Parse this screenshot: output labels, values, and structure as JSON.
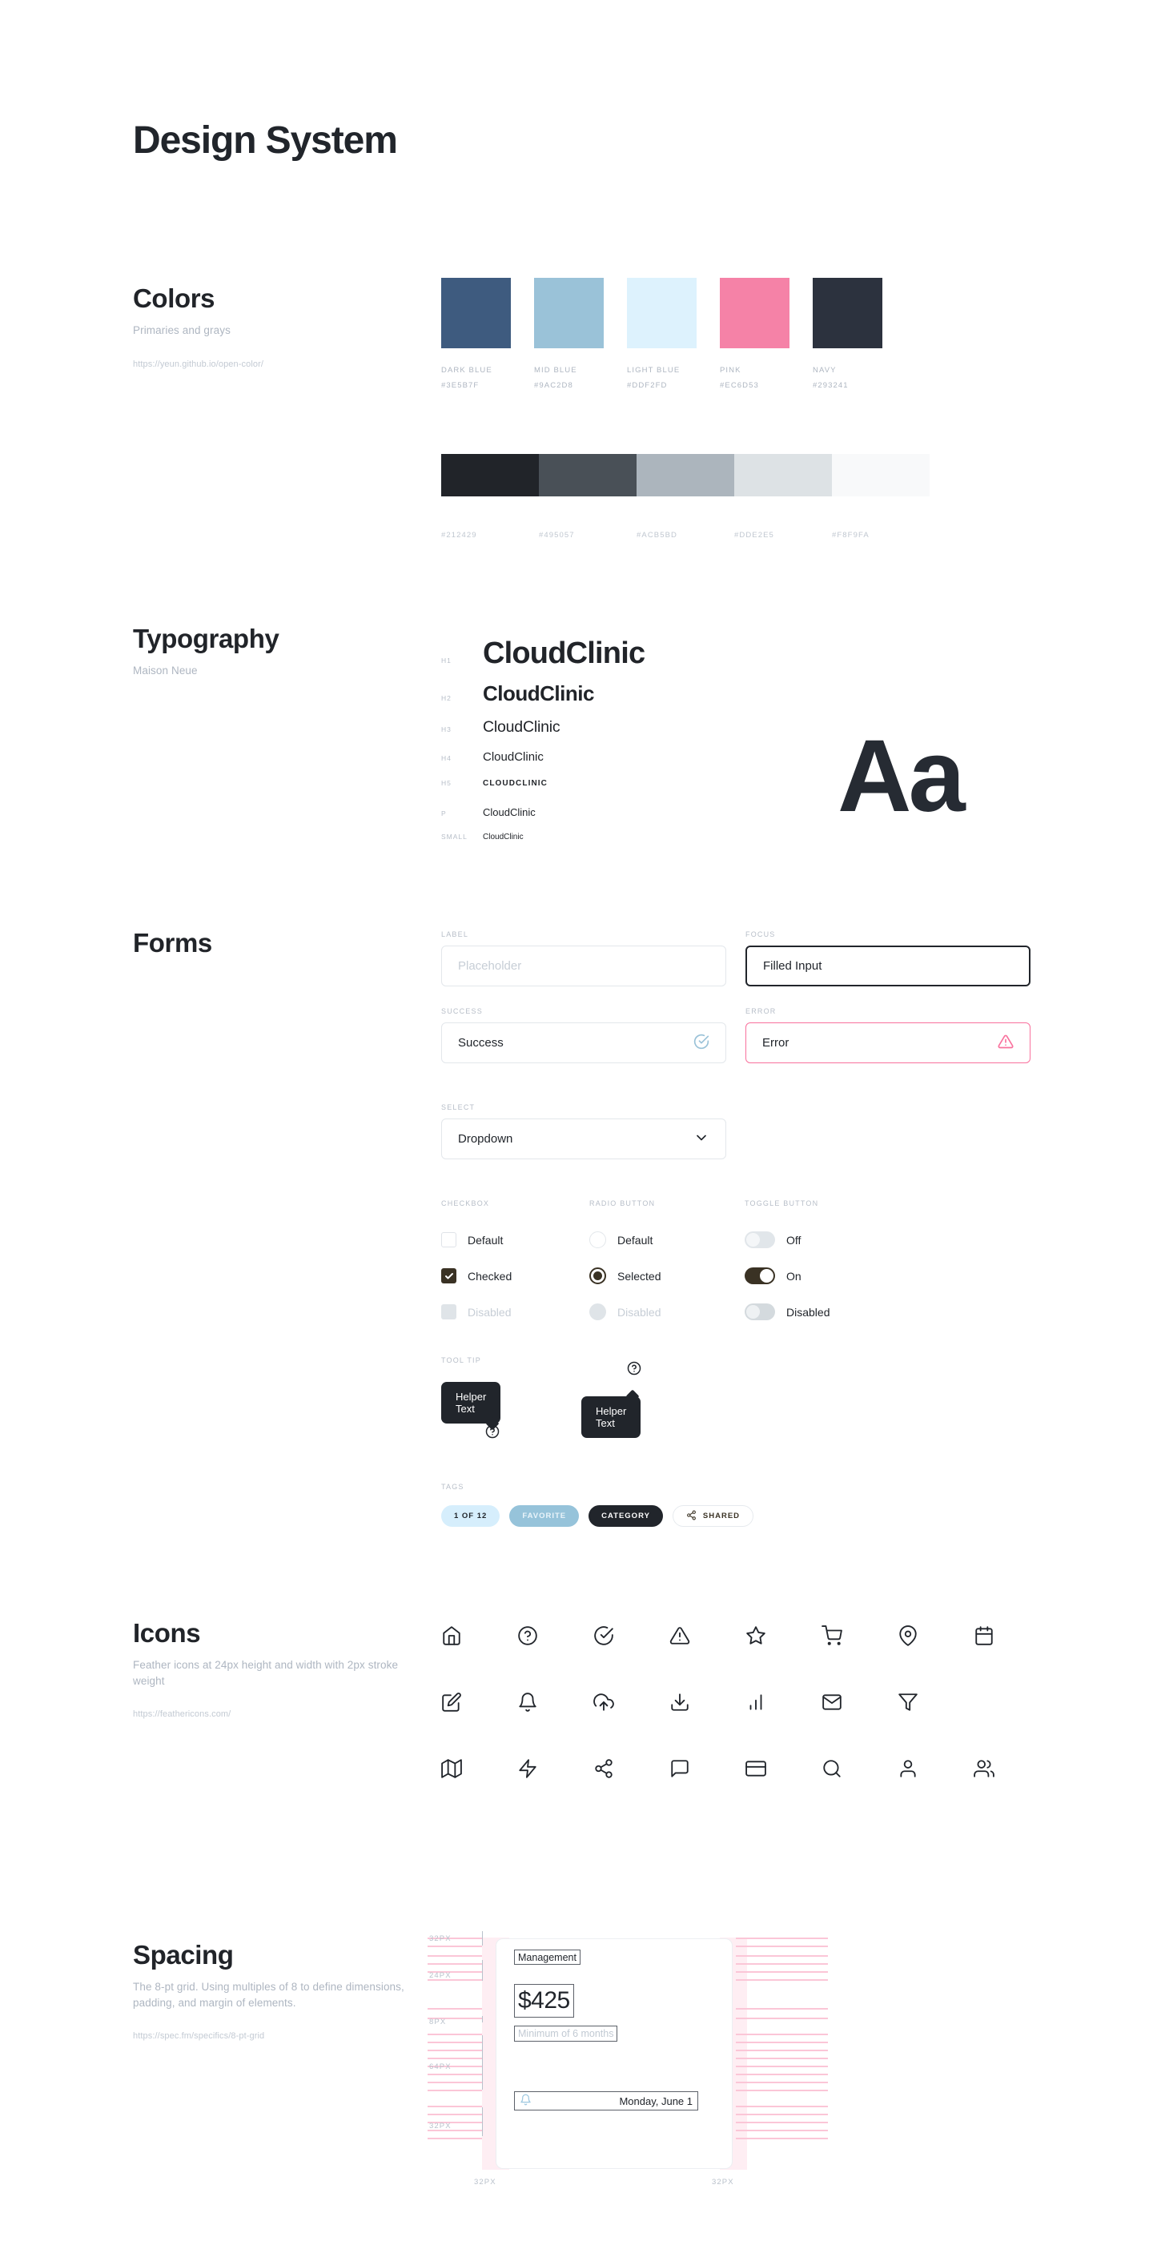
{
  "page": {
    "title": "Design System"
  },
  "colors": {
    "heading": "Colors",
    "subtitle": "Primaries and grays",
    "url": "https://yeun.github.io/open-color/",
    "primaries": [
      {
        "name": "DARK BLUE",
        "hex": "#3E5B7F"
      },
      {
        "name": "MID BLUE",
        "hex": "#9AC2D8"
      },
      {
        "name": "LIGHT BLUE",
        "hex": "#DDF2FD"
      },
      {
        "name": "PINK",
        "hex": "#EC6D53"
      },
      {
        "name": "NAVY",
        "hex": "#293241"
      }
    ],
    "primary_swatch_colors": [
      "#3E5B7F",
      "#9AC2D8",
      "#DDF2FD",
      "#F582A7",
      "#2C323E"
    ],
    "grays": [
      {
        "hex": "#212429"
      },
      {
        "hex": "#495057"
      },
      {
        "hex": "#ACB5BD"
      },
      {
        "hex": "#DDE2E5"
      },
      {
        "hex": "#F8F9FA"
      }
    ]
  },
  "typography": {
    "heading": "Typography",
    "subtitle": "Maison Neue",
    "specimen": "Aa",
    "rows": [
      {
        "tag": "H1",
        "sample": "CloudClinic"
      },
      {
        "tag": "H2",
        "sample": "CloudClinic"
      },
      {
        "tag": "H3",
        "sample": "CloudClinic"
      },
      {
        "tag": "H4",
        "sample": "CloudClinic"
      },
      {
        "tag": "H5",
        "sample": "CLOUDCLINIC"
      },
      {
        "tag": "P",
        "sample": "CloudClinic"
      },
      {
        "tag": "SMALL",
        "sample": "CloudClinic"
      }
    ]
  },
  "forms": {
    "heading": "Forms",
    "fields": {
      "label": {
        "label": "LABEL",
        "placeholder": "Placeholder",
        "value": ""
      },
      "focus": {
        "label": "FOCUS",
        "value": "Filled Input"
      },
      "success": {
        "label": "SUCCESS",
        "value": "Success"
      },
      "error": {
        "label": "ERROR",
        "value": "Error"
      },
      "select": {
        "label": "SELECT",
        "value": "Dropdown"
      }
    },
    "checkbox": {
      "label": "CHECKBOX",
      "items": [
        "Default",
        "Checked",
        "Disabled"
      ]
    },
    "radio": {
      "label": "RADIO BUTTON",
      "items": [
        "Default",
        "Selected",
        "Disabled"
      ]
    },
    "toggle": {
      "label": "TOGGLE BUTTON",
      "items": [
        "Off",
        "On",
        "Disabled"
      ]
    },
    "tooltip": {
      "label": "TOOL TIP",
      "top_text": "Helper Text",
      "bottom_text": "Helper Text"
    },
    "tags": {
      "label": "TAGS",
      "items": [
        "1 OF 12",
        "FAVORITE",
        "CATEGORY",
        "SHARED"
      ]
    }
  },
  "icons": {
    "heading": "Icons",
    "subtitle": "Feather icons at 24px height and width with 2px stroke weight",
    "url": "https://feathericons.com/",
    "names": [
      "home-icon",
      "help-circle-icon",
      "check-circle-icon",
      "alert-triangle-icon",
      "star-icon",
      "shopping-cart-icon",
      "map-pin-icon",
      "calendar-icon",
      "edit-icon",
      "bell-icon",
      "upload-cloud-icon",
      "download-icon",
      "bar-chart-icon",
      "mail-icon",
      "filter-icon",
      "map-icon",
      "zap-icon",
      "share-icon",
      "message-square-icon",
      "credit-card-icon",
      "search-icon",
      "user-icon",
      "users-icon"
    ]
  },
  "spacing": {
    "heading": "Spacing",
    "subtitle": "The 8-pt grid. Using multiples of 8 to define dimensions, padding, and margin of elements.",
    "url": "https://spec.fm/specifics/8-pt-grid",
    "row_labels": [
      "32PX",
      "24PX",
      "8PX",
      "64PX",
      "32PX"
    ],
    "bottom_labels": [
      "32PX",
      "32PX"
    ],
    "card": {
      "title": "Management",
      "amount": "$425",
      "note": "Minimum of 6 months",
      "date": "Monday, June 1"
    }
  }
}
